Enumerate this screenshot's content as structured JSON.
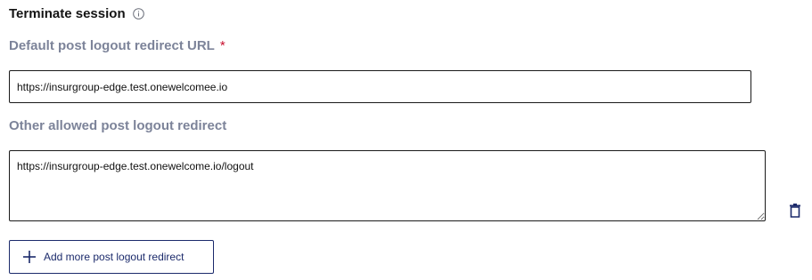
{
  "section": {
    "title": "Terminate session",
    "info_icon": "info-circle-icon"
  },
  "default_redirect": {
    "label": "Default post logout redirect URL",
    "required_marker": "*",
    "value": "https://insurgroup-edge.test.onewelcomee.io"
  },
  "other_redirects": {
    "label": "Other allowed post logout redirect",
    "items": [
      {
        "value": "https://insurgroup-edge.test.onewelcome.io/logout",
        "delete_icon": "trash-icon"
      }
    ]
  },
  "add_button": {
    "label": "Add more post logout redirect",
    "icon": "plus-icon"
  },
  "colors": {
    "label_gray": "#7c8399",
    "required_red": "#c8102e",
    "accent_navy": "#1b2a6b"
  }
}
